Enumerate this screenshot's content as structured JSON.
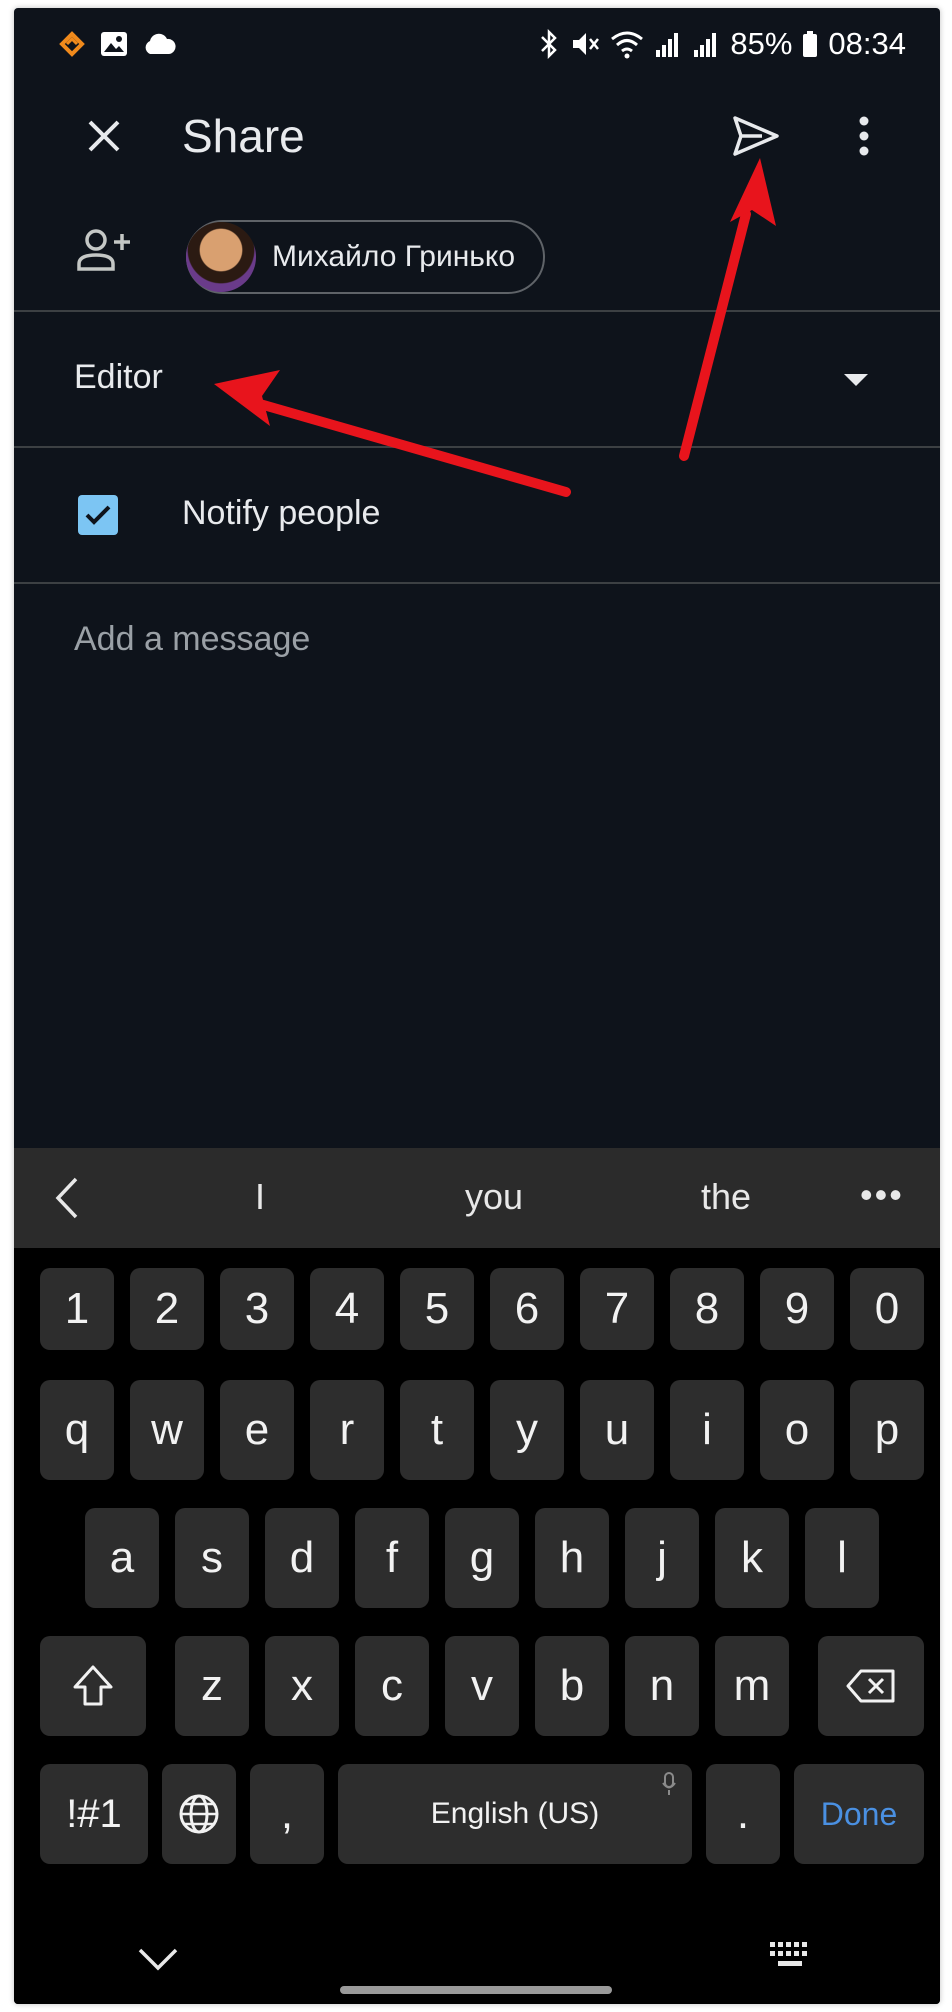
{
  "status_bar": {
    "battery": "85%",
    "time": "08:34",
    "left_icons": [
      "app-notification-icon",
      "image-icon",
      "cloud-icon"
    ],
    "right_icons": [
      "bluetooth-icon",
      "mute-icon",
      "wifi-icon",
      "signal-icon",
      "signal-icon-2",
      "battery-icon"
    ]
  },
  "app_bar": {
    "title": "Share",
    "close_icon": "close-icon",
    "send_icon": "send-icon",
    "more_icon": "more-vert-icon"
  },
  "recipients": {
    "add_icon": "add-person-icon",
    "chips": [
      {
        "name": "Михайло Гринько"
      }
    ]
  },
  "role": {
    "label": "Editor",
    "dropdown_icon": "dropdown-arrow-icon"
  },
  "notify": {
    "label": "Notify people",
    "checked": true
  },
  "message": {
    "placeholder": "Add a message"
  },
  "keyboard": {
    "suggestions": [
      "I",
      "you",
      "the"
    ],
    "more": "•••",
    "rows": [
      [
        "1",
        "2",
        "3",
        "4",
        "5",
        "6",
        "7",
        "8",
        "9",
        "0"
      ],
      [
        "q",
        "w",
        "e",
        "r",
        "t",
        "y",
        "u",
        "i",
        "o",
        "p"
      ],
      [
        "a",
        "s",
        "d",
        "f",
        "g",
        "h",
        "j",
        "k",
        "l"
      ],
      [
        "z",
        "x",
        "c",
        "v",
        "b",
        "n",
        "m"
      ]
    ],
    "symbols_key": "!#1",
    "comma_key": ",",
    "space_label": "English (US)",
    "period_key": ".",
    "done_label": "Done"
  },
  "colors": {
    "background": "#0e131b",
    "checkbox": "#7cc5f3",
    "annotation_arrow": "#e8141c",
    "done_text": "#4a90e2"
  }
}
